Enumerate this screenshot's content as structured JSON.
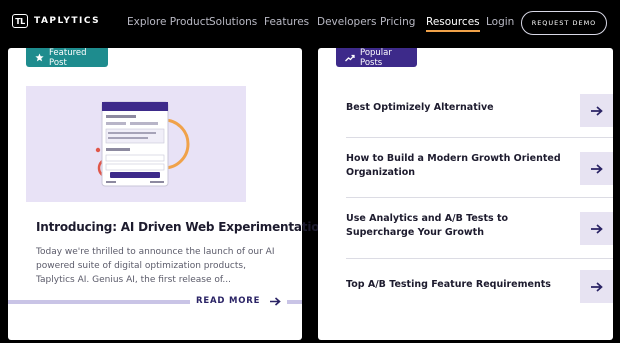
{
  "nav": {
    "logo_text": "TAPLYTICS",
    "logo_mark": "TL",
    "links": [
      "Explore Product",
      "Solutions",
      "Features",
      "Developers",
      "Pricing",
      "Resources",
      "Login"
    ],
    "active_link": "Resources",
    "cta": "REQUEST DEMO",
    "accent_color": "#f0a24a"
  },
  "featured": {
    "tag": "Featured Post",
    "tag_icon": "star-icon",
    "tag_color": "#1e8c8e",
    "title": "Introducing: AI Driven Web Experimentation",
    "excerpt": "Today we're thrilled to announce the launch of our AI powered suite of digital optimization products, Taplytics AI. Genius AI, the first release of...",
    "read_more": "READ MORE"
  },
  "popular": {
    "tag": "Popular Posts",
    "tag_icon": "trending-icon",
    "tag_color": "#3d2a8a",
    "items": [
      "Best Optimizely Alternative",
      "How to Build a Modern Growth Oriented Organization",
      "Use Analytics and A/B Tests to Supercharge Your Growth",
      "Top A/B Testing Feature Requirements"
    ]
  }
}
